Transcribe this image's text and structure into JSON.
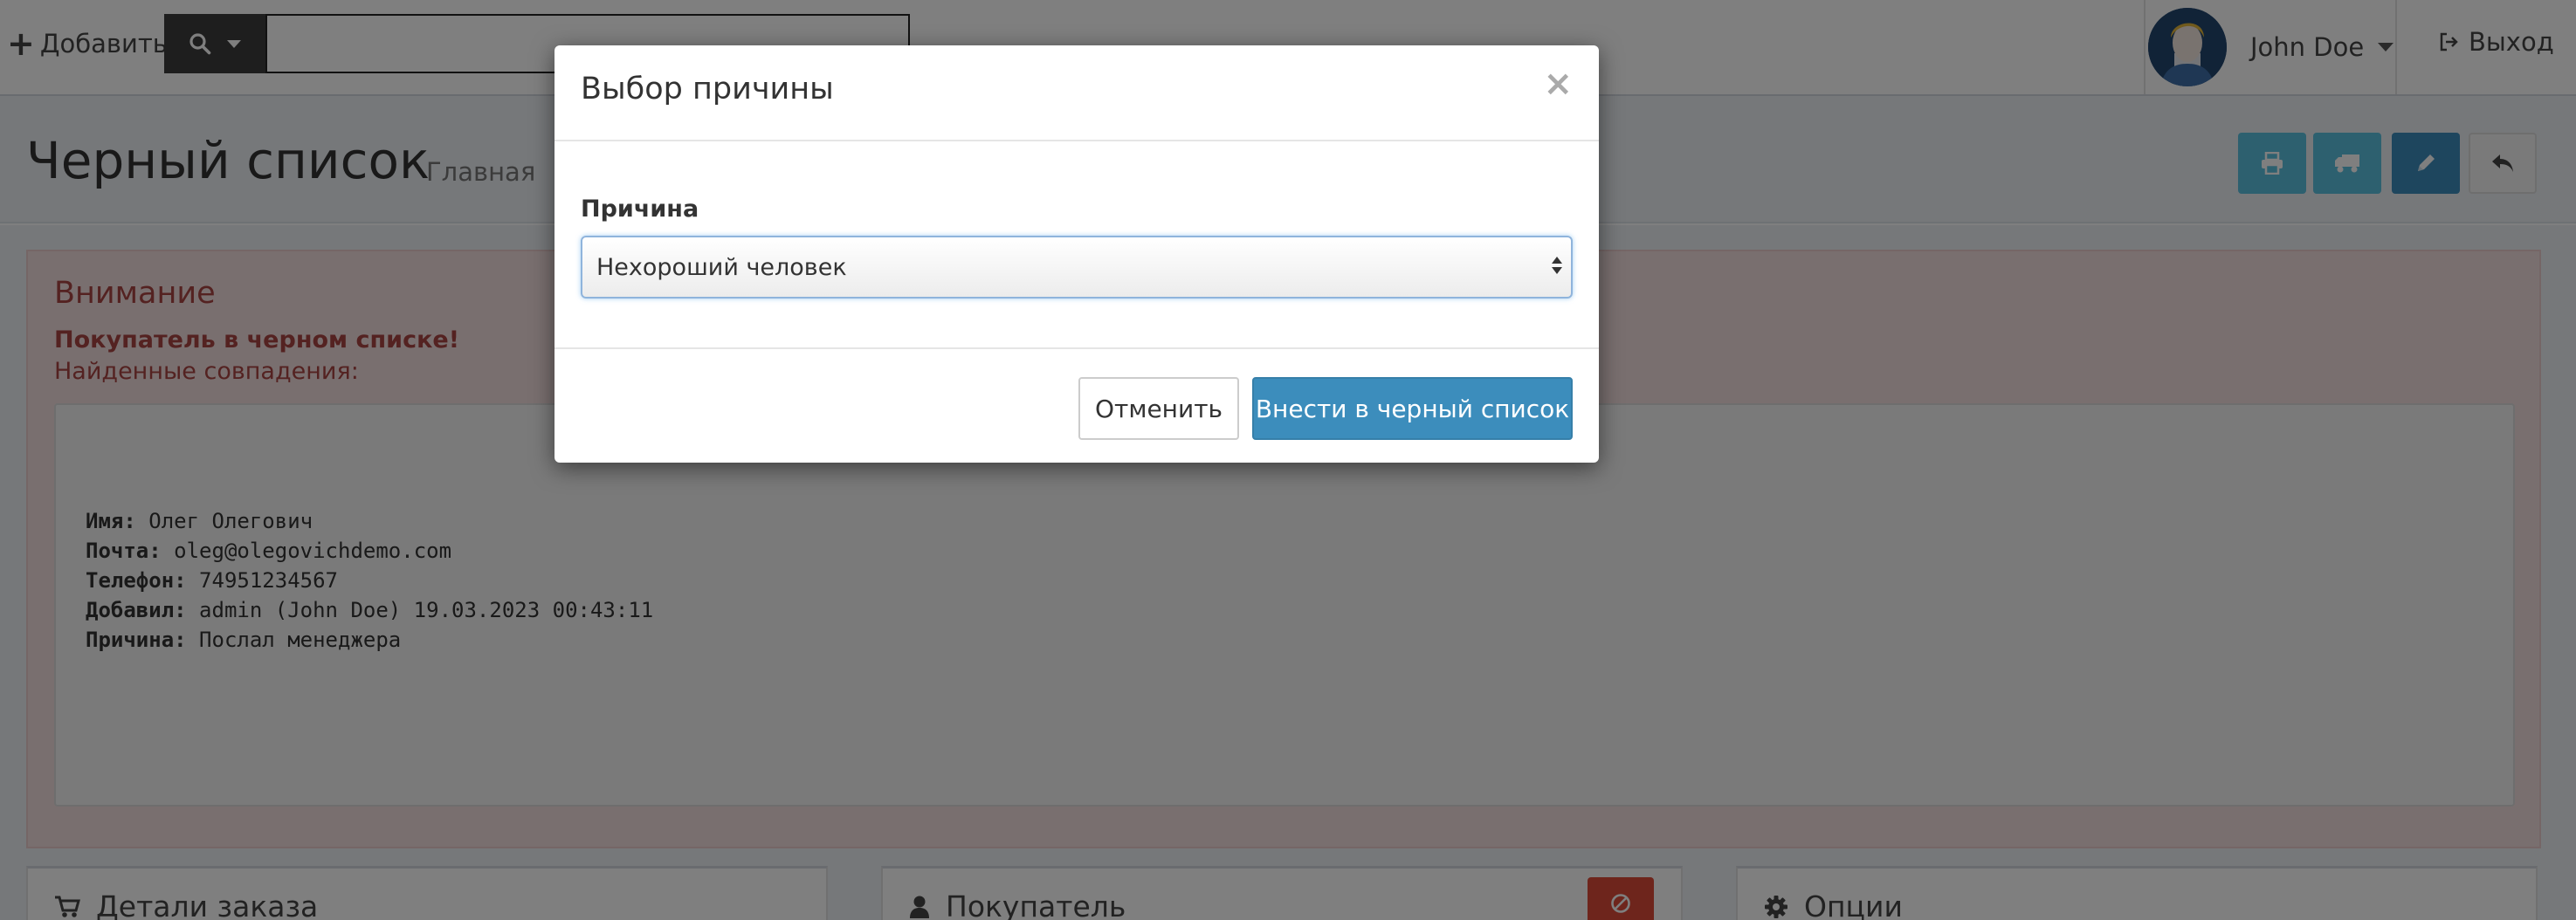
{
  "topbar": {
    "add_label": "Добавить",
    "search_placeholder": "",
    "user_name": "John Doe",
    "logout_label": "Выход"
  },
  "header": {
    "title": "Черный список",
    "breadcrumb_home": "Главная",
    "breadcrumb_sep": "›"
  },
  "alert": {
    "title": "Внимание",
    "strong_text": "Покупатель в черном списке!",
    "text": "Найденные совпадения:",
    "matches": [
      {
        "label": "Имя:",
        "value": "Олег Олегович"
      },
      {
        "label": "Почта:",
        "value": "oleg@olegovichdemo.com"
      },
      {
        "label": "Телефон:",
        "value": "74951234567"
      },
      {
        "label": "Добавил:",
        "value": "admin (John Doe) 19.03.2023 00:43:11"
      },
      {
        "label": "Причина:",
        "value": "Послал менеджера"
      }
    ]
  },
  "boxes": {
    "order_details": "Детали заказа",
    "customer": "Покупатель",
    "options": "Опции"
  },
  "modal": {
    "title": "Выбор причины",
    "close": "×",
    "field_label": "Причина",
    "selected_reason": "Нехороший человек",
    "cancel_label": "Отменить",
    "submit_label": "Внести в черный список"
  },
  "colors": {
    "primary": "#3c8dbc",
    "info": "#5bc0de",
    "danger": "#dd4b39",
    "alert_bg": "#f2dede"
  },
  "icons": {
    "add": "plus-icon",
    "search": "search-icon",
    "logout": "sign-out-icon",
    "print": "print-icon",
    "shipping": "truck-icon",
    "edit": "pencil-icon",
    "back": "reply-icon",
    "cart": "shopping-cart-icon",
    "user": "user-icon",
    "options": "gear-icon",
    "block": "ban-icon"
  }
}
